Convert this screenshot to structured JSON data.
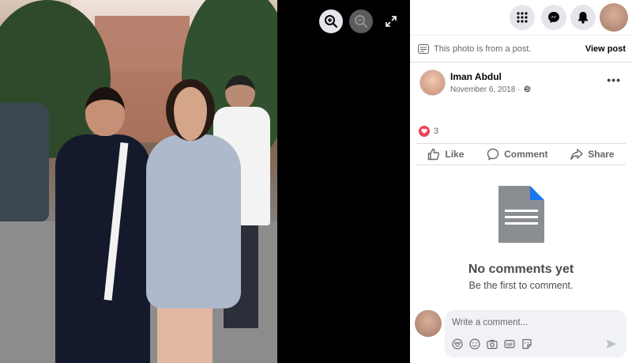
{
  "viewer": {
    "zoom_in_icon": "zoom-in-icon",
    "zoom_out_icon": "zoom-out-icon",
    "fullscreen_icon": "expand-icon"
  },
  "topbar": {
    "menu_icon": "grid-menu-icon",
    "messenger_icon": "messenger-icon",
    "notifications_icon": "bell-icon"
  },
  "notice": {
    "text": "This photo is from a post.",
    "link": "View post"
  },
  "post": {
    "author": "Iman Abdul",
    "date": "November 6, 2018 ·",
    "privacy_icon": "globe-icon",
    "more_icon": "more-options-icon",
    "more_label": "•••"
  },
  "reactions": {
    "count": "3",
    "icon": "heart-icon"
  },
  "actions": {
    "like": "Like",
    "comment": "Comment",
    "share": "Share"
  },
  "empty_state": {
    "title": "No comments yet",
    "subtitle": "Be the first to comment."
  },
  "composer": {
    "placeholder": "Write a comment...",
    "tools": [
      "avatar-sticker-icon",
      "emoji-icon",
      "camera-icon",
      "gif-icon",
      "sticker-icon"
    ],
    "send_icon": "send-icon"
  },
  "colors": {
    "brand_blue": "#1877f2",
    "heart_red": "#f33e58",
    "text_secondary": "#65676b"
  }
}
